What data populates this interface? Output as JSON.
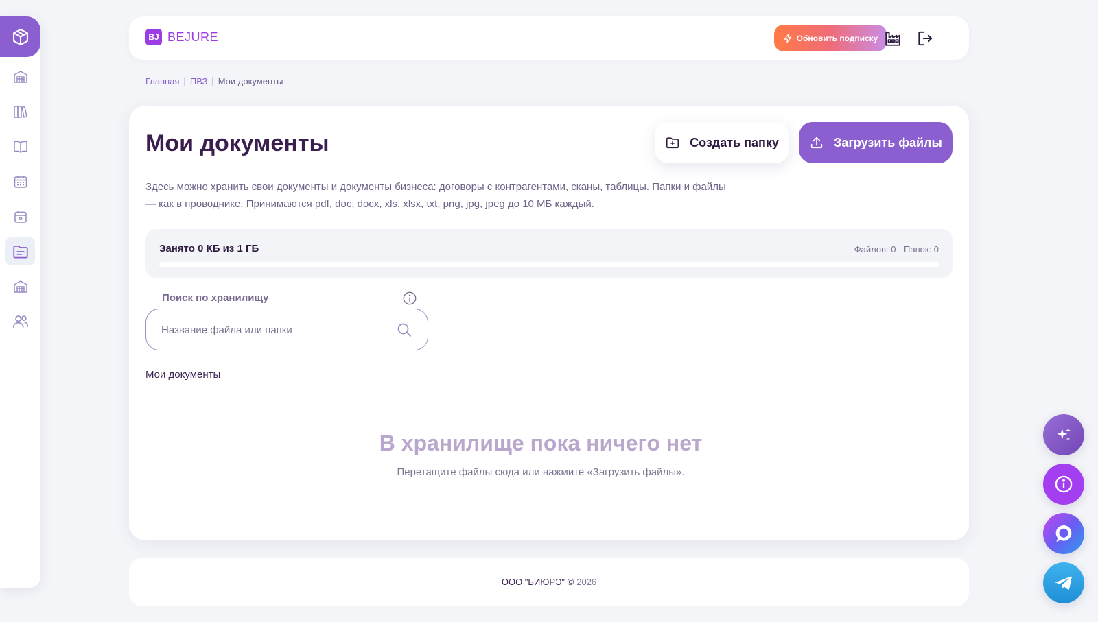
{
  "app": {
    "brand_mark": "BJ",
    "brand_name": "BEJURE"
  },
  "header": {
    "upgrade_label": "Обновить подписку",
    "icons": [
      "factory-icon",
      "logout-icon"
    ]
  },
  "sidebar": {
    "items": [
      {
        "name": "home",
        "icon": "warehouse-icon",
        "active": false
      },
      {
        "name": "catalog",
        "icon": "book-stack-icon",
        "active": false
      },
      {
        "name": "guide",
        "icon": "open-book-icon",
        "active": false
      },
      {
        "name": "schedule",
        "icon": "calendar-grid-icon",
        "active": false
      },
      {
        "name": "calendar",
        "icon": "calendar-icon",
        "active": false
      },
      {
        "name": "documents",
        "icon": "folder-icon",
        "active": true
      },
      {
        "name": "pvz",
        "icon": "warehouse-icon",
        "active": false
      },
      {
        "name": "users",
        "icon": "users-icon",
        "active": false
      }
    ]
  },
  "breadcrumb": {
    "home": "Главная",
    "pvz": "ПВЗ",
    "current": "Мои документы",
    "separator": "|"
  },
  "page": {
    "title": "Мои документы",
    "create_folder_label": "Создать папку",
    "upload_label": "Загрузить файлы",
    "description": "Здесь можно хранить свои документы и документы бизнеса: договоры с контрагентами, сканы, таблицы. Папки и файлы — как в проводнике. Принимаются pdf, doc, docx, xls, xlsx, txt, png, jpg, jpeg до 10 МБ каждый."
  },
  "storage": {
    "used_label": "Занято 0 КБ из 1 ГБ",
    "counts_label": "Файлов: 0 · Папок: 0",
    "used_fraction": 0
  },
  "search": {
    "label": "Поиск по хранилищу",
    "placeholder": "Название файла или папки",
    "value": ""
  },
  "folder_path": "Мои документы",
  "empty_state": {
    "title": "В хранилище пока ничего нет",
    "hint": "Перетащите файлы сюда или нажмите «Загрузить файлы»."
  },
  "footer": {
    "company": "ООО \"БИЮРЭ\" ©",
    "year": "2026"
  },
  "colors": {
    "accent": "#8b5fcf",
    "brand": "#9b3ce4",
    "background": "#f3f5f8",
    "upgrade_gradient_start": "#ff7a45",
    "upgrade_gradient_end": "#c98de6"
  }
}
